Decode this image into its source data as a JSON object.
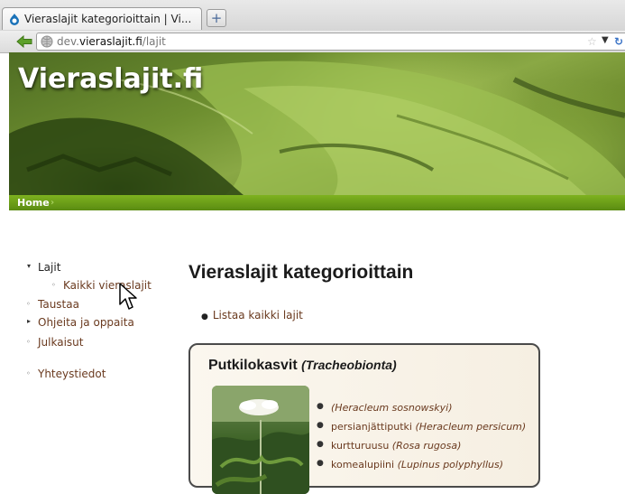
{
  "browser": {
    "tab_title": "Vieraslajit kategorioittain | Vi...",
    "new_tab_symbol": "+",
    "url_prefix": "dev.",
    "url_domain": "vieraslajit.fi",
    "url_path": "/lajit"
  },
  "site": {
    "name": "Vieraslajit.fi",
    "breadcrumb_home": "Home",
    "breadcrumb_sep": "›"
  },
  "sidebar": {
    "items": [
      {
        "label": "Lajit",
        "marker": "▾"
      },
      {
        "label": "Kaikki vieraslajit",
        "marker": "◦"
      },
      {
        "label": "Taustaa",
        "marker": "◦"
      },
      {
        "label": "Ohjeita ja oppaita",
        "marker": "▸"
      },
      {
        "label": "Julkaisut",
        "marker": "◦"
      },
      {
        "label": "Yhteystiedot",
        "marker": "◦"
      }
    ]
  },
  "main": {
    "title": "Vieraslajit kategorioittain",
    "list_all_link": "Listaa kaikki lajit",
    "category": {
      "name": "Putkilokasvit",
      "latin": "(Tracheobionta)",
      "species": [
        {
          "common": "",
          "latin": "(Heracleum sosnowskyi)"
        },
        {
          "common": "persianjättiputki",
          "latin": "(Heracleum persicum)"
        },
        {
          "common": "kurtturuusu",
          "latin": "(Rosa rugosa)"
        },
        {
          "common": "komealupiini",
          "latin": "(Lupinus polyphyllus)"
        }
      ]
    }
  },
  "colors": {
    "link": "#6a3a1f",
    "breadcrumb_bar": "#6a9e18",
    "box_border": "#4a4a4a"
  },
  "icons": {
    "favicon": "drupal-drop-icon",
    "back": "back-arrow-icon",
    "site_identity": "globe-icon",
    "bookmark": "star-icon",
    "reload": "reload-icon",
    "cursor": "mouse-pointer-icon"
  }
}
